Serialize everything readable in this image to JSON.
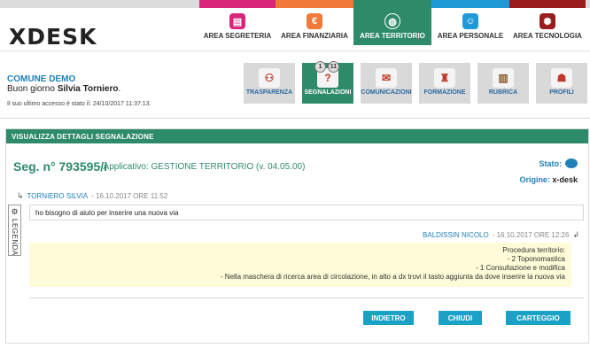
{
  "brand": {
    "logo": "XDESK"
  },
  "colors": {
    "strip": [
      "#dcdcdc",
      "#d8267a",
      "#f07a3a",
      "#2e8b6a",
      "#1f9ad6",
      "#9b1c1c",
      "#dcdcdc"
    ],
    "accent": "#2e8b6a",
    "link": "#1f80b8",
    "button": "#1aa2c6",
    "note_bg": "#fefbd8"
  },
  "areas": [
    {
      "label": "AREA SEGRETERIA",
      "icon": "clipboard-icon",
      "color": "#d8267a",
      "active": false
    },
    {
      "label": "AREA FINANZIARIA",
      "icon": "euro-icon",
      "color": "#f07a3a",
      "active": false
    },
    {
      "label": "AREA TERRITORIO",
      "icon": "globe-icon",
      "color": "#2e8b6a",
      "active": true
    },
    {
      "label": "AREA PERSONALE",
      "icon": "people-icon",
      "color": "#1f9ad6",
      "active": false
    },
    {
      "label": "AREA TECNOLOGIA",
      "icon": "atom-icon",
      "color": "#9b1c1c",
      "active": false
    }
  ],
  "user": {
    "comune": "COMUNE DEMO",
    "greeting_prefix": "Buon giorno",
    "name": "Silvia Torniero",
    "last_access": "Il suo ultimo accesso è stato il: 24/10/2017 11:37:13."
  },
  "modules": [
    {
      "label": "TRASPARENZA",
      "icon": "handshake-icon",
      "active": false
    },
    {
      "label": "SEGNALAZIONI",
      "icon": "question-icon",
      "active": true,
      "badges": [
        "1",
        "11"
      ]
    },
    {
      "label": "COMUNICAZIONI",
      "icon": "megaphone-icon",
      "active": false
    },
    {
      "label": "FORMAZIONE",
      "icon": "training-icon",
      "active": false
    },
    {
      "label": "RUBRICA",
      "icon": "book-icon",
      "active": false
    },
    {
      "label": "PROFILI",
      "icon": "profile-icon",
      "active": false
    }
  ],
  "panel": {
    "header": "VISUALIZZA DETTAGLI SEGNALAZIONE",
    "seg_number": "Seg. n° 793595/i",
    "application": "- Applicativo: GESTIONE TERRITORIO (v. 04.05.00)",
    "stato_label": "Stato:",
    "origine_label": "Origine:",
    "origine_value": "x-desk",
    "legend_label": "LEGENDA",
    "message1": {
      "author": "TORNIERO SILVIA",
      "date": "- 16.10.2017 ORE 11:52",
      "text": "ho bisogno di aiuto per inserire una nuova via"
    },
    "message2": {
      "author": "BALDISSIN NICOLO",
      "date": "- 16.10.2017 ORE 12:26",
      "lines": [
        "Procedura territorio:",
        "- 2 Toponomastica",
        "- 1 Consultazione e modifica",
        "- Nella maschera di ricerca area di circolazione, in alto a dx trovi il tasto aggiunta da dove inserire la nuova via"
      ]
    },
    "buttons": {
      "back": "INDIETRO",
      "close": "CHIUDI",
      "file": "CARTEGGIO"
    }
  }
}
